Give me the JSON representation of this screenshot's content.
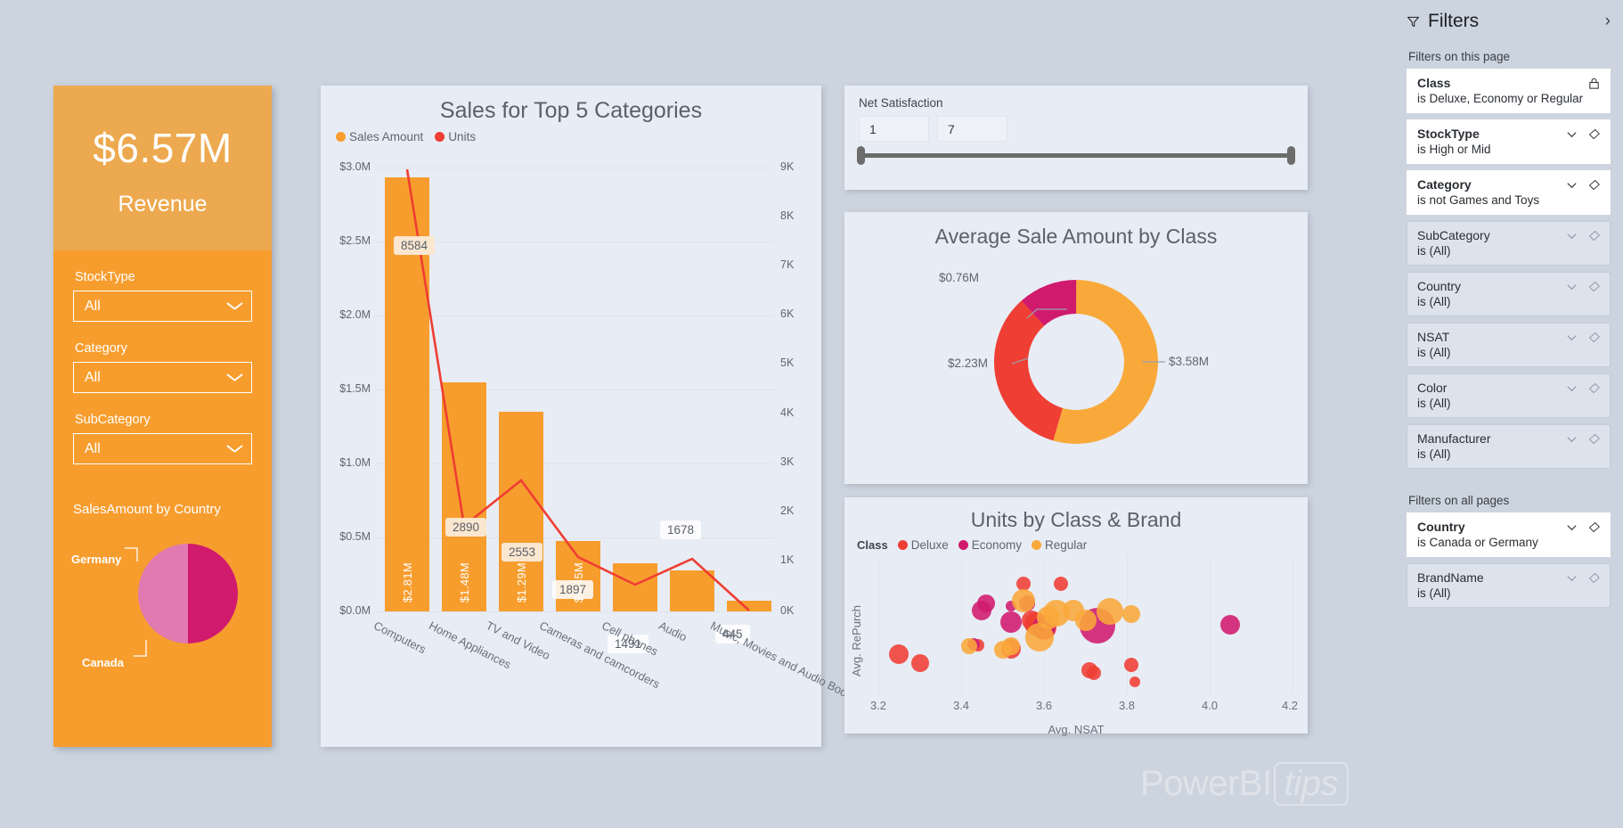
{
  "left_card": {
    "kpi_value": "$6.57M",
    "kpi_label": "Revenue",
    "slicers": [
      {
        "label": "StockType",
        "value": "All"
      },
      {
        "label": "Category",
        "value": "All"
      },
      {
        "label": "SubCategory",
        "value": "All"
      }
    ],
    "pie_title": "SalesAmount by Country",
    "pie_labels": {
      "germany": "Germany",
      "canada": "Canada"
    }
  },
  "bar_panel": {
    "title": "Sales for Top 5 Categories",
    "legend": [
      {
        "name": "Sales Amount",
        "color": "#f79d2e"
      },
      {
        "name": "Units",
        "color": "#ef3e33"
      }
    ]
  },
  "nsat_panel": {
    "label": "Net Satisfaction",
    "min_value": "1",
    "max_value": "7"
  },
  "donut_panel": {
    "title": "Average Sale Amount by Class"
  },
  "bubble_panel": {
    "title": "Units by Class & Brand",
    "legend_title": "Class",
    "legend": [
      {
        "name": "Deluxe",
        "color": "#ef3e33"
      },
      {
        "name": "Economy",
        "color": "#d01a6e"
      },
      {
        "name": "Regular",
        "color": "#f9a93a"
      }
    ]
  },
  "watermark": {
    "brand": "PowerBI",
    "suffix": "tips"
  },
  "filters": {
    "title": "Filters",
    "expand_icon": "chevron-right-icon",
    "funnel_icon": "funnel-icon",
    "section_page": "Filters on this page",
    "section_all": "Filters on all pages",
    "page_filters": [
      {
        "name": "Class",
        "condition": "is Deluxe, Economy or Regular",
        "active": true,
        "icon": "lock-icon"
      },
      {
        "name": "StockType",
        "condition": "is High or Mid",
        "active": true,
        "icon": "clear-icon"
      },
      {
        "name": "Category",
        "condition": "is not Games and Toys",
        "active": true,
        "icon": "clear-icon"
      },
      {
        "name": "SubCategory",
        "condition": "is (All)",
        "active": false,
        "icon": "clear-icon"
      },
      {
        "name": "Country",
        "condition": "is (All)",
        "active": false,
        "icon": "clear-icon"
      },
      {
        "name": "NSAT",
        "condition": "is (All)",
        "active": false,
        "icon": "clear-icon"
      },
      {
        "name": "Color",
        "condition": "is (All)",
        "active": false,
        "icon": "clear-icon"
      },
      {
        "name": "Manufacturer",
        "condition": "is (All)",
        "active": false,
        "icon": "clear-icon"
      }
    ],
    "all_page_filters": [
      {
        "name": "Country",
        "condition": "is Canada or Germany",
        "active": true,
        "icon": "clear-icon"
      },
      {
        "name": "BrandName",
        "condition": "is (All)",
        "active": false,
        "icon": "clear-icon"
      }
    ]
  },
  "chart_data": [
    {
      "type": "bar",
      "id": "sales-top-5-categories",
      "title": "Sales for Top 5 Categories",
      "categories": [
        "Computers",
        "Home Appliances",
        "TV and Video",
        "Cameras and camcorders",
        "Cell phones",
        "Audio",
        "Music, Movies and Audio Books"
      ],
      "series": [
        {
          "name": "Sales Amount",
          "type": "bar",
          "axis": "left",
          "values": [
            2.81,
            1.48,
            1.29,
            0.45,
            0.3,
            0.25,
            0.06
          ],
          "labels": [
            "$2.81M",
            "$1.48M",
            "$1.29M",
            "$0.45M",
            "",
            "",
            ""
          ],
          "color": "#f79d2e"
        },
        {
          "name": "Units",
          "type": "line",
          "axis": "right",
          "values": [
            8584,
            2890,
            2553,
            1897,
            1491,
            1678,
            445
          ],
          "labels": [
            "8584",
            "2890",
            "2553",
            "1897",
            "1491",
            "1678",
            "445"
          ],
          "color": "#ef3e33"
        }
      ],
      "ylabel": "",
      "xlabel": "",
      "ylim": [
        0,
        3.0
      ],
      "yticks": [
        "$0.0M",
        "$0.5M",
        "$1.0M",
        "$1.5M",
        "$2.0M",
        "$2.5M",
        "$3.0M"
      ],
      "y2lim": [
        0,
        9000
      ],
      "y2ticks": [
        "0K",
        "1K",
        "2K",
        "3K",
        "4K",
        "5K",
        "6K",
        "7K",
        "8K",
        "9K"
      ],
      "grid": true,
      "legend_position": "top-left"
    },
    {
      "type": "pie",
      "id": "salesamount-by-country",
      "title": "SalesAmount by Country",
      "labels": [
        "Germany",
        "Canada"
      ],
      "values": [
        52,
        48
      ],
      "colors": [
        "#e07ab0",
        "#d01a6e"
      ],
      "legend_position": "callout"
    },
    {
      "type": "pie",
      "id": "average-sale-amount-by-class",
      "title": "Average Sale Amount by Class",
      "donut": true,
      "labels": [
        "$3.58M",
        "$2.23M",
        "$0.76M"
      ],
      "values": [
        3.58,
        2.23,
        0.76
      ],
      "value_labels": [
        "$3.58M",
        "$2.23M",
        "$0.76M"
      ],
      "colors": [
        "#f9a93a",
        "#ef3e33",
        "#d01a6e"
      ],
      "legend_position": "callout"
    },
    {
      "type": "scatter",
      "id": "units-by-class-and-brand",
      "title": "Units by Class & Brand",
      "xlabel": "Avg. NSAT",
      "ylabel": "Avg. RePurch",
      "xlim": [
        3.15,
        4.25
      ],
      "xticks": [
        3.2,
        3.4,
        3.6,
        3.8,
        4.0,
        4.2
      ],
      "xtick_labels": [
        "3.2",
        "3.4",
        "3.6",
        "3.8",
        "4.0",
        "4.2"
      ],
      "legend_title": "Class",
      "series": [
        {
          "name": "Deluxe",
          "color": "#ef3e33",
          "points": [
            {
              "x": 3.25,
              "y": 0.3,
              "r": 11
            },
            {
              "x": 3.3,
              "y": 0.22,
              "r": 10
            },
            {
              "x": 3.55,
              "y": 0.88,
              "r": 8
            },
            {
              "x": 3.64,
              "y": 0.88,
              "r": 8
            },
            {
              "x": 3.57,
              "y": 0.58,
              "r": 11
            },
            {
              "x": 3.58,
              "y": 0.55,
              "r": 13
            },
            {
              "x": 3.6,
              "y": 0.52,
              "r": 14
            },
            {
              "x": 3.52,
              "y": 0.34,
              "r": 11
            },
            {
              "x": 3.71,
              "y": 0.16,
              "r": 9
            },
            {
              "x": 3.72,
              "y": 0.14,
              "r": 8
            },
            {
              "x": 3.81,
              "y": 0.21,
              "r": 8
            },
            {
              "x": 3.82,
              "y": 0.07,
              "r": 6
            },
            {
              "x": 3.44,
              "y": 0.37,
              "r": 7
            }
          ]
        },
        {
          "name": "Economy",
          "color": "#d01a6e",
          "points": [
            {
              "x": 3.46,
              "y": 0.72,
              "r": 10
            },
            {
              "x": 3.45,
              "y": 0.66,
              "r": 11
            },
            {
              "x": 3.52,
              "y": 0.7,
              "r": 6
            },
            {
              "x": 3.56,
              "y": 0.72,
              "r": 9
            },
            {
              "x": 3.52,
              "y": 0.56,
              "r": 12
            },
            {
              "x": 3.6,
              "y": 0.52,
              "r": 13
            },
            {
              "x": 3.73,
              "y": 0.53,
              "r": 20
            },
            {
              "x": 4.05,
              "y": 0.54,
              "r": 11
            },
            {
              "x": 3.43,
              "y": 0.38,
              "r": 7
            }
          ]
        },
        {
          "name": "Regular",
          "color": "#f9a93a",
          "points": [
            {
              "x": 3.55,
              "y": 0.74,
              "r": 13
            },
            {
              "x": 3.61,
              "y": 0.6,
              "r": 13
            },
            {
              "x": 3.63,
              "y": 0.64,
              "r": 15
            },
            {
              "x": 3.67,
              "y": 0.66,
              "r": 12
            },
            {
              "x": 3.76,
              "y": 0.65,
              "r": 15
            },
            {
              "x": 3.81,
              "y": 0.63,
              "r": 10
            },
            {
              "x": 3.7,
              "y": 0.58,
              "r": 12
            },
            {
              "x": 3.59,
              "y": 0.44,
              "r": 16
            },
            {
              "x": 3.5,
              "y": 0.33,
              "r": 10
            },
            {
              "x": 3.52,
              "y": 0.36,
              "r": 10
            },
            {
              "x": 3.42,
              "y": 0.36,
              "r": 9
            }
          ]
        }
      ],
      "grid": true,
      "legend_position": "top-left"
    }
  ]
}
